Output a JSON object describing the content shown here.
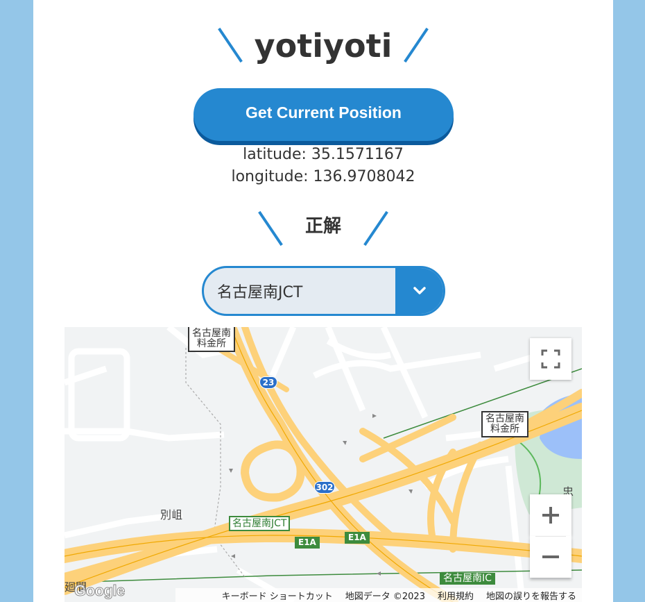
{
  "app": {
    "title": "yotiyoti",
    "accent": "#2588d0",
    "background": "#94c6e8"
  },
  "actions": {
    "get_position_label": "Get Current Position"
  },
  "position": {
    "latitude_text": "latitude: 35.1571167",
    "longitude_text": "longitude: 136.9708042"
  },
  "answer": {
    "heading": "正解",
    "selected_option": "名古屋南JCT",
    "arrow_icon": "chevron-down-icon"
  },
  "map": {
    "labels": {
      "tollgate_top": "名古屋南\n料金所",
      "tollgate_right": "名古屋南\n料金所",
      "jct": "名古屋南JCT",
      "ic": "名古屋南IC",
      "area_left": "別岨",
      "area_right": "忠",
      "edge_left": "廻間",
      "route_23": "23",
      "route_302": "302",
      "e1a_1": "E1A",
      "e1a_2": "E1A",
      "logo": "Google"
    },
    "controls": {
      "fullscreen_icon": "fullscreen-icon",
      "zoom_in_icon": "plus-icon",
      "zoom_out_icon": "minus-icon"
    },
    "footer": {
      "shortcuts": "キーボード ショートカット",
      "map_data": "地図データ ©2023",
      "terms": "利用規約",
      "report": "地図の誤りを報告する"
    }
  }
}
